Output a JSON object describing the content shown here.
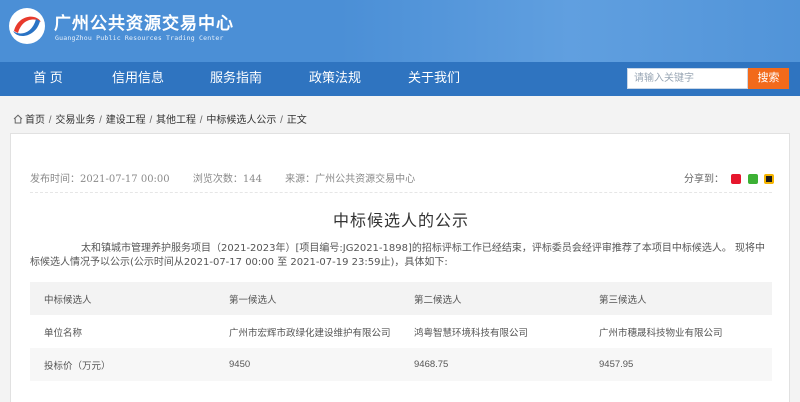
{
  "header": {
    "title": "广州公共资源交易中心",
    "subtitle": "GuangZhou Public Resources Trading Center",
    "brand_color": "#4b8fd6"
  },
  "nav": {
    "items": [
      {
        "label": "首 页"
      },
      {
        "label": "信用信息"
      },
      {
        "label": "服务指南"
      },
      {
        "label": "政策法规"
      },
      {
        "label": "关于我们"
      }
    ],
    "search": {
      "placeholder": "请输入关键字",
      "value": "",
      "button_label": "搜索"
    },
    "nav_color": "#2f74c0",
    "search_button_color": "#f26a1b"
  },
  "breadcrumb": {
    "items": [
      "首页",
      "交易业务",
      "建设工程",
      "其他工程",
      "中标候选人公示",
      "正文"
    ],
    "separator": "/"
  },
  "article": {
    "publish_time": "发布时间：2021-07-17 00:00",
    "view_count": "浏览次数：144",
    "source": "来源：广州公共资源交易中心",
    "share_label": "分享到：",
    "share_icons": [
      "weibo-icon",
      "wechat-icon",
      "qq-icon"
    ],
    "title": "中标候选人的公示",
    "body": "太和镇城市管理养护服务项目（2021-2023年）[项目编号:JG2021-1898]的招标评标工作已经结束，评标委员会经评审推荐了本项目中标候选人。 现将中标候选人情况予以公示(公示时间从2021-07-17 00:00 至 2021-07-19 23:59止)，具体如下:"
  },
  "table": {
    "headers": [
      "中标候选人",
      "第一候选人",
      "第二候选人",
      "第三候选人"
    ],
    "rows": [
      [
        "单位名称",
        "广州市宏辉市政绿化建设维护有限公司",
        "鸿粤智慧环境科技有限公司",
        "广州市穗晟科技物业有限公司"
      ],
      [
        "投标价（万元）",
        "9450",
        "9468.75",
        "9457.95"
      ]
    ]
  }
}
